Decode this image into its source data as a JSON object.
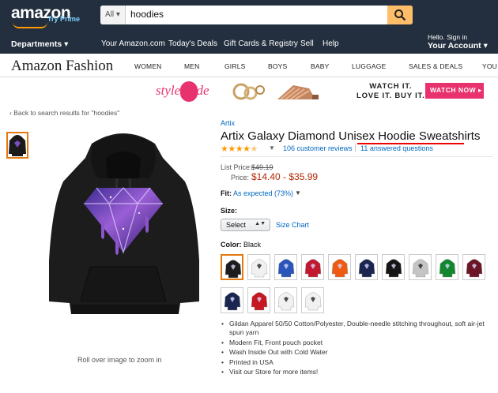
{
  "header": {
    "logo": "amazon",
    "prime": "Try Prime",
    "search_category": "All",
    "search_value": "hoodies",
    "departments": "Departments",
    "nav": [
      "Your Amazon.com",
      "Today's Deals",
      "Gift Cards & Registry",
      "Sell",
      "Help"
    ],
    "account_small": "Hello. Sign in",
    "account_big": "Your Account"
  },
  "fashion_nav": {
    "brand": "Amazon Fashion",
    "items": [
      "WOMEN",
      "MEN",
      "GIRLS",
      "BOYS",
      "BABY",
      "LUGGAGE",
      "SALES & DEALS",
      "YOU"
    ]
  },
  "banner": {
    "stylecode": "style code",
    "watch_line1": "WATCH IT.",
    "watch_line2": "LOVE IT. BUY IT.",
    "watch_button": "WATCH NOW ▸"
  },
  "back_link": "‹ Back to search results for \"hoodies\"",
  "rollover": "Roll over image to zoom in",
  "product": {
    "brand": "Artix",
    "title": "Artix Galaxy Diamond Unisex Hoodie Sweatshirts",
    "rating": 4.5,
    "reviews": "106 customer reviews",
    "questions": "11 answered questions",
    "list_price_label": "List Price:",
    "list_price": "$49.19",
    "price_label": "Price:",
    "price": "$14.40 - $35.99",
    "fit_label": "Fit:",
    "fit_value": "As expected (73%)",
    "size_label": "Size:",
    "size_select": "Select",
    "size_chart": "Size Chart",
    "color_label": "Color:",
    "color_value": "Black",
    "colors": [
      "black",
      "white",
      "royal-blue",
      "red-purple-design",
      "orange",
      "navy",
      "black-white",
      "heather-grey",
      "green",
      "maroon",
      "navy",
      "red",
      "white",
      "white"
    ],
    "bullets": [
      "Gildan Apparel 50/50 Cotton/Polyester, Double-needle stitching throughout, soft air-jet spun yarn",
      "Modern Fit, Front pouch pocket",
      "Wash Inside Out with Cold Water",
      "Printed in USA",
      "Visit our Store for more items!"
    ]
  },
  "colors": {
    "header_bg": "#232f3e",
    "accent": "#febd69",
    "link": "#0066c0",
    "price": "#b12704",
    "selected": "#e47911"
  }
}
